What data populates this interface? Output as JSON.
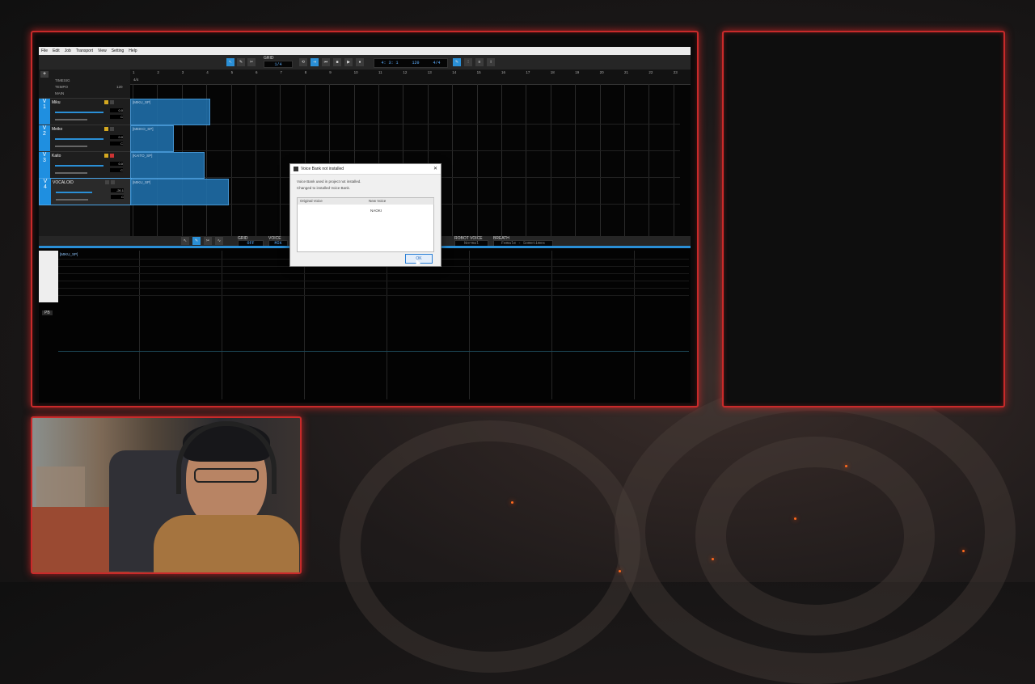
{
  "app": {
    "menu": [
      "File",
      "Edit",
      "Job",
      "Transport",
      "View",
      "Setting",
      "Help"
    ],
    "toolbar": {
      "grid_label": "GRID",
      "grid_value": "1/4",
      "position": "4: 3: 1",
      "tempo": "120",
      "timesig": "4/4"
    },
    "master": {
      "timesig": "TIMESIG",
      "tempo": "TEMPO",
      "tempo_value": "120",
      "main": "MAIN",
      "ts_value": "4/4"
    },
    "ruler_numbers": [
      "1",
      "2",
      "3",
      "4",
      "5",
      "6",
      "7",
      "8",
      "9",
      "10",
      "11",
      "12",
      "13",
      "14",
      "15",
      "16",
      "17",
      "18",
      "19",
      "20",
      "21",
      "22",
      "23"
    ],
    "tracks": [
      {
        "num": "1",
        "name": "Miku",
        "part": "[MIKU_SP]",
        "val1": "0.0",
        "val2": "C"
      },
      {
        "num": "2",
        "name": "Meiko",
        "part": "[MEIKO_SP]",
        "val1": "0.0",
        "val2": "C"
      },
      {
        "num": "3",
        "name": "Kaito",
        "part": "[KAITO_SP]",
        "val1": "0.0",
        "val2": "C"
      },
      {
        "num": "4",
        "name": "VOCALOID",
        "part": "[MIKU_SP]",
        "val1": "-26.1",
        "val2": "C"
      }
    ],
    "editor": {
      "grid_label": "GRID",
      "grid_value": "OFF",
      "voice_label": "VOICE",
      "voice_value": "MIK",
      "robot_label": "ROBOT VOICE",
      "robot_value": "Normal",
      "breath_label": "BREATH",
      "breath_value": "Female - Sometimes",
      "part_label": "[MIKU_SP]",
      "pb_label": "PB"
    }
  },
  "dialog": {
    "title": "Voice Bank not installed",
    "line1": "Voice Bank used in project not installed.",
    "line2": "Changed to installed Voice Bank.",
    "col_original": "Original Voice",
    "col_new": "New Voice",
    "row_new": "NAOKI",
    "ok_label": "OK"
  },
  "colors": {
    "accent": "#2a8fd6",
    "frame": "#c92a2a",
    "ember": "#ff6a1e"
  }
}
